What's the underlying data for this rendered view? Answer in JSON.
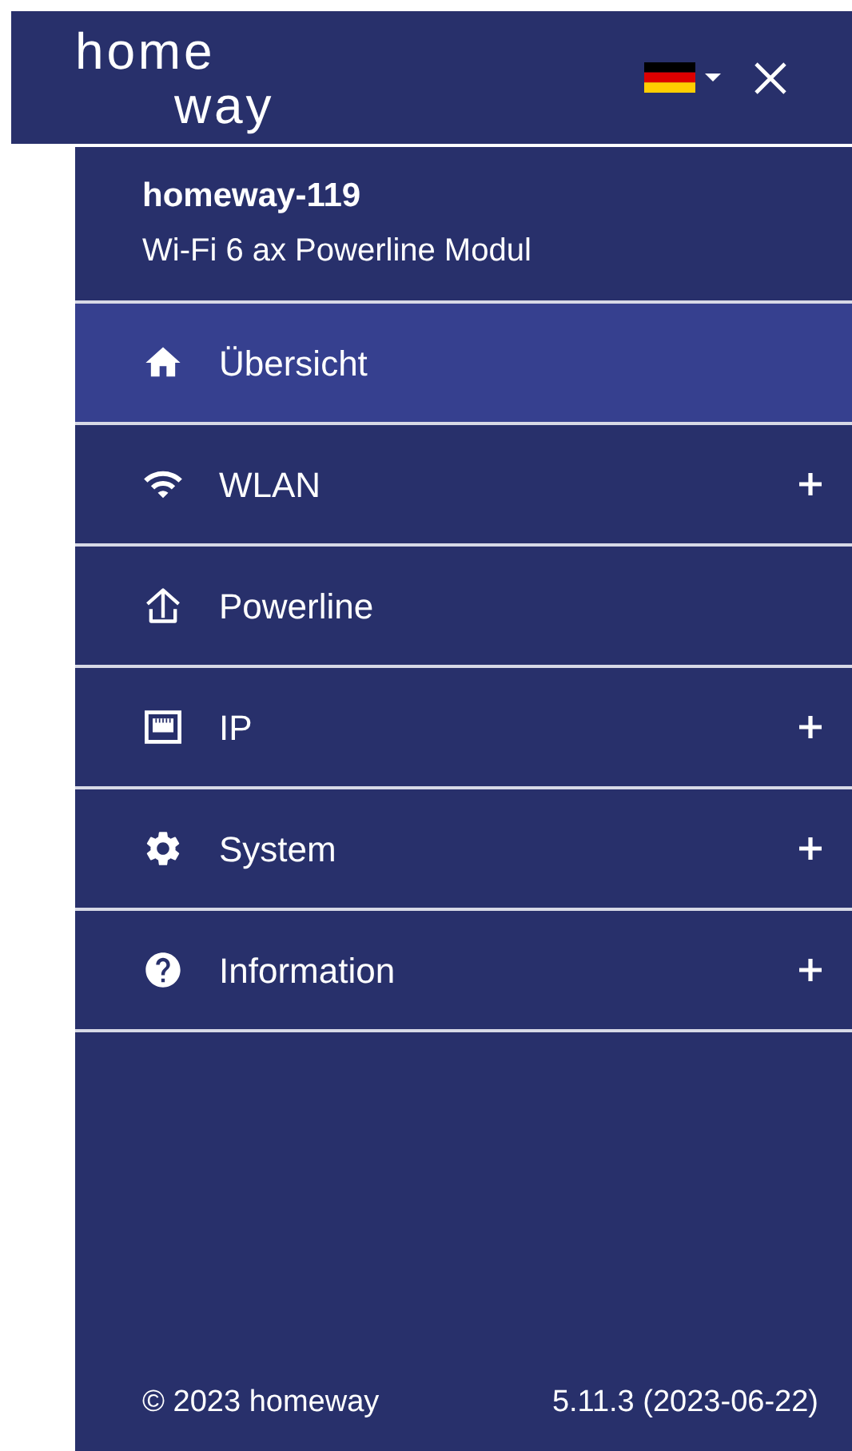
{
  "header": {
    "logo": {
      "line_1": "home",
      "line_2": "way"
    }
  },
  "device": {
    "name": "homeway-119",
    "model": "Wi-Fi 6 ax Powerline Modul"
  },
  "menu": [
    {
      "label": "Übersicht",
      "kind": "home",
      "selected": true,
      "expandable": false
    },
    {
      "label": "WLAN",
      "kind": "wifi",
      "selected": false,
      "expandable": true
    },
    {
      "label": "Powerline",
      "kind": "powerline",
      "selected": false,
      "expandable": false
    },
    {
      "label": "IP",
      "kind": "ip",
      "selected": false,
      "expandable": true
    },
    {
      "label": "System",
      "kind": "system",
      "selected": false,
      "expandable": true
    },
    {
      "label": "Information",
      "kind": "information",
      "selected": false,
      "expandable": true
    }
  ],
  "footer": {
    "copyright": "© 2023 homeway",
    "version": "5.11.3 (2023-06-22)"
  }
}
